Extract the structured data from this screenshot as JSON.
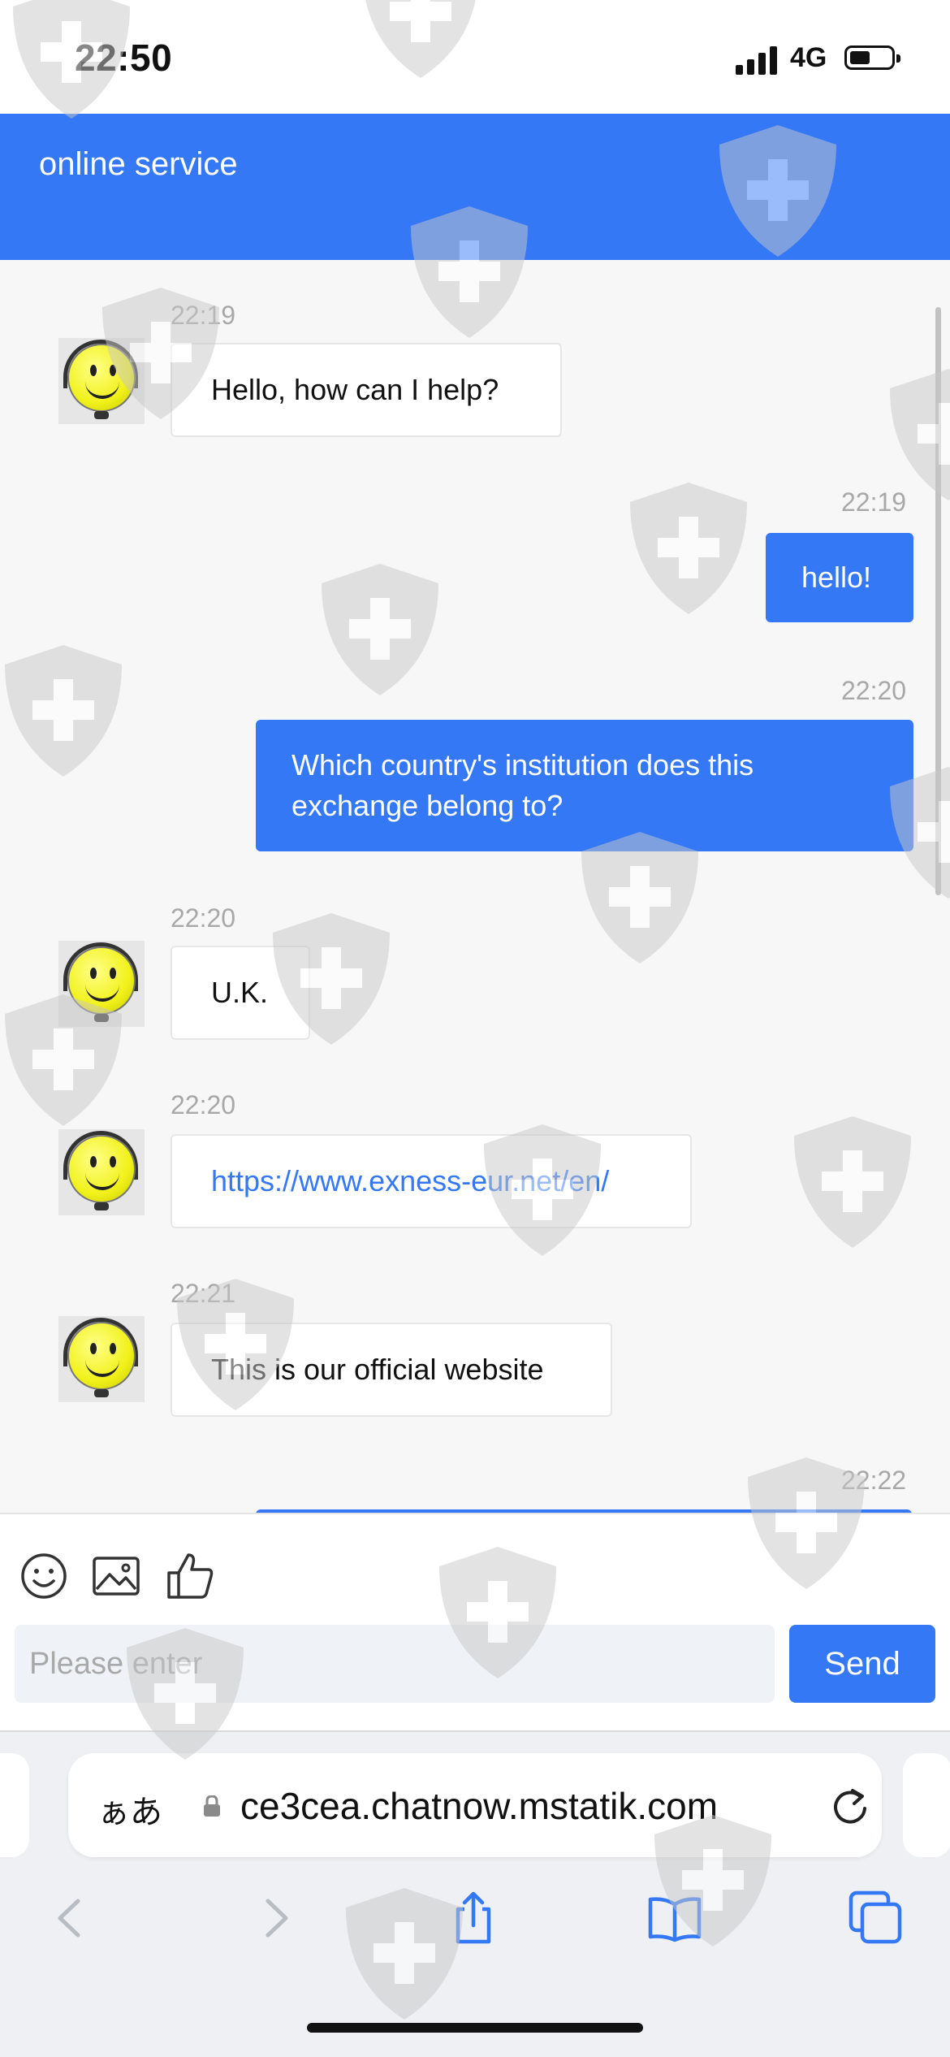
{
  "status_bar": {
    "time": "22:50",
    "network": "4G",
    "battery_level": 0.5
  },
  "header": {
    "title": "online service"
  },
  "messages": [
    {
      "time": "22:19",
      "from": "agent",
      "text": "Hello, how can I help?"
    },
    {
      "time": "22:19",
      "from": "user",
      "text": "hello!"
    },
    {
      "time": "22:20",
      "from": "user",
      "text": "Which country's institution does this exchange belong to?"
    },
    {
      "time": "22:20",
      "from": "agent",
      "text": "U.K."
    },
    {
      "time": "22:20",
      "from": "agent",
      "text": "https://www.exness-eur.net/en/",
      "is_link": true
    },
    {
      "time": "22:21",
      "from": "agent",
      "text": "This is our official website"
    },
    {
      "time": "22:22",
      "from": "user",
      "text": ""
    }
  ],
  "composer": {
    "tools": [
      "emoji-icon",
      "image-icon",
      "thumbs-up-icon"
    ],
    "input_value": "",
    "input_placeholder": "Please enter",
    "send_label": "Send"
  },
  "browser": {
    "text_size_label": "ぁあ",
    "url": "ce3cea.chatnow.mstatik.com",
    "nav": [
      "back-icon",
      "forward-icon",
      "share-icon",
      "bookmarks-icon",
      "tabs-icon"
    ]
  },
  "colors": {
    "accent": "#3478f6",
    "background": "#f7f7f7",
    "watermark": "#c8c8c8"
  }
}
